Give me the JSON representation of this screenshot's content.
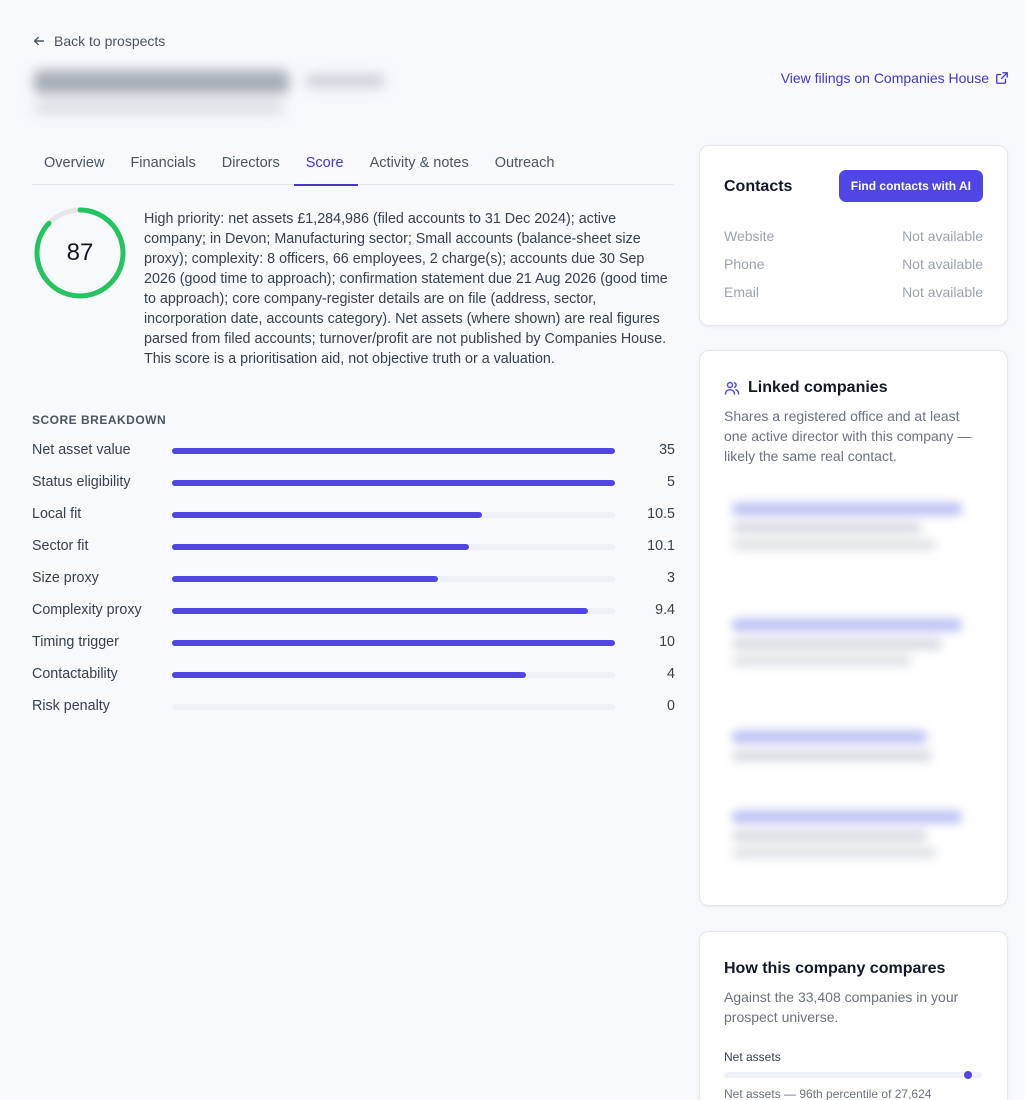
{
  "nav": {
    "back_label": "Back to prospects",
    "filings_label": "View filings on Companies House"
  },
  "tabs": [
    {
      "label": "Overview",
      "active": false
    },
    {
      "label": "Financials",
      "active": false
    },
    {
      "label": "Directors",
      "active": false
    },
    {
      "label": "Score",
      "active": true
    },
    {
      "label": "Activity & notes",
      "active": false
    },
    {
      "label": "Outreach",
      "active": false
    }
  ],
  "score": {
    "value": "87",
    "fraction": 0.87,
    "color": "#22c55e",
    "summary": "High priority: net assets £1,284,986 (filed accounts to 31 Dec 2024); active company; in Devon; Manufacturing sector; Small accounts (balance-sheet size proxy); complexity: 8 officers, 66 employees, 2 charge(s); accounts due 30 Sep 2026 (good time to approach); confirmation statement due 21 Aug 2026 (good time to approach); core company-register details are on file (address, sector, incorporation date, accounts category). Net assets (where shown) are real figures parsed from filed accounts; turnover/profit are not published by Companies House. This score is a prioritisation aid, not objective truth or a valuation."
  },
  "breakdown": {
    "title": "SCORE BREAKDOWN",
    "rows": [
      {
        "label": "Net asset value",
        "value": "35",
        "fraction": 1.0
      },
      {
        "label": "Status eligibility",
        "value": "5",
        "fraction": 1.0
      },
      {
        "label": "Local fit",
        "value": "10.5",
        "fraction": 0.7
      },
      {
        "label": "Sector fit",
        "value": "10.1",
        "fraction": 0.67
      },
      {
        "label": "Size proxy",
        "value": "3",
        "fraction": 0.6
      },
      {
        "label": "Complexity proxy",
        "value": "9.4",
        "fraction": 0.94
      },
      {
        "label": "Timing trigger",
        "value": "10",
        "fraction": 1.0
      },
      {
        "label": "Contactability",
        "value": "4",
        "fraction": 0.8
      },
      {
        "label": "Risk penalty",
        "value": "0",
        "fraction": 0.0
      }
    ]
  },
  "contacts": {
    "title": "Contacts",
    "button": "Find contacts with AI",
    "rows": [
      {
        "key": "Website",
        "value": "Not available"
      },
      {
        "key": "Phone",
        "value": "Not available"
      },
      {
        "key": "Email",
        "value": "Not available"
      }
    ]
  },
  "linked": {
    "title": "Linked companies",
    "description": "Shares a registered office and at least one active director with this company — likely the same real contact."
  },
  "compare": {
    "title": "How this company compares",
    "description": "Against the 33,408 companies in your prospect universe.",
    "metric_label": "Net assets",
    "metric_percentile": 0.96,
    "metric_note": "Net assets — 96th percentile of 27,624"
  },
  "colors": {
    "accent": "#4f46e5",
    "score_ring": "#22c55e"
  }
}
